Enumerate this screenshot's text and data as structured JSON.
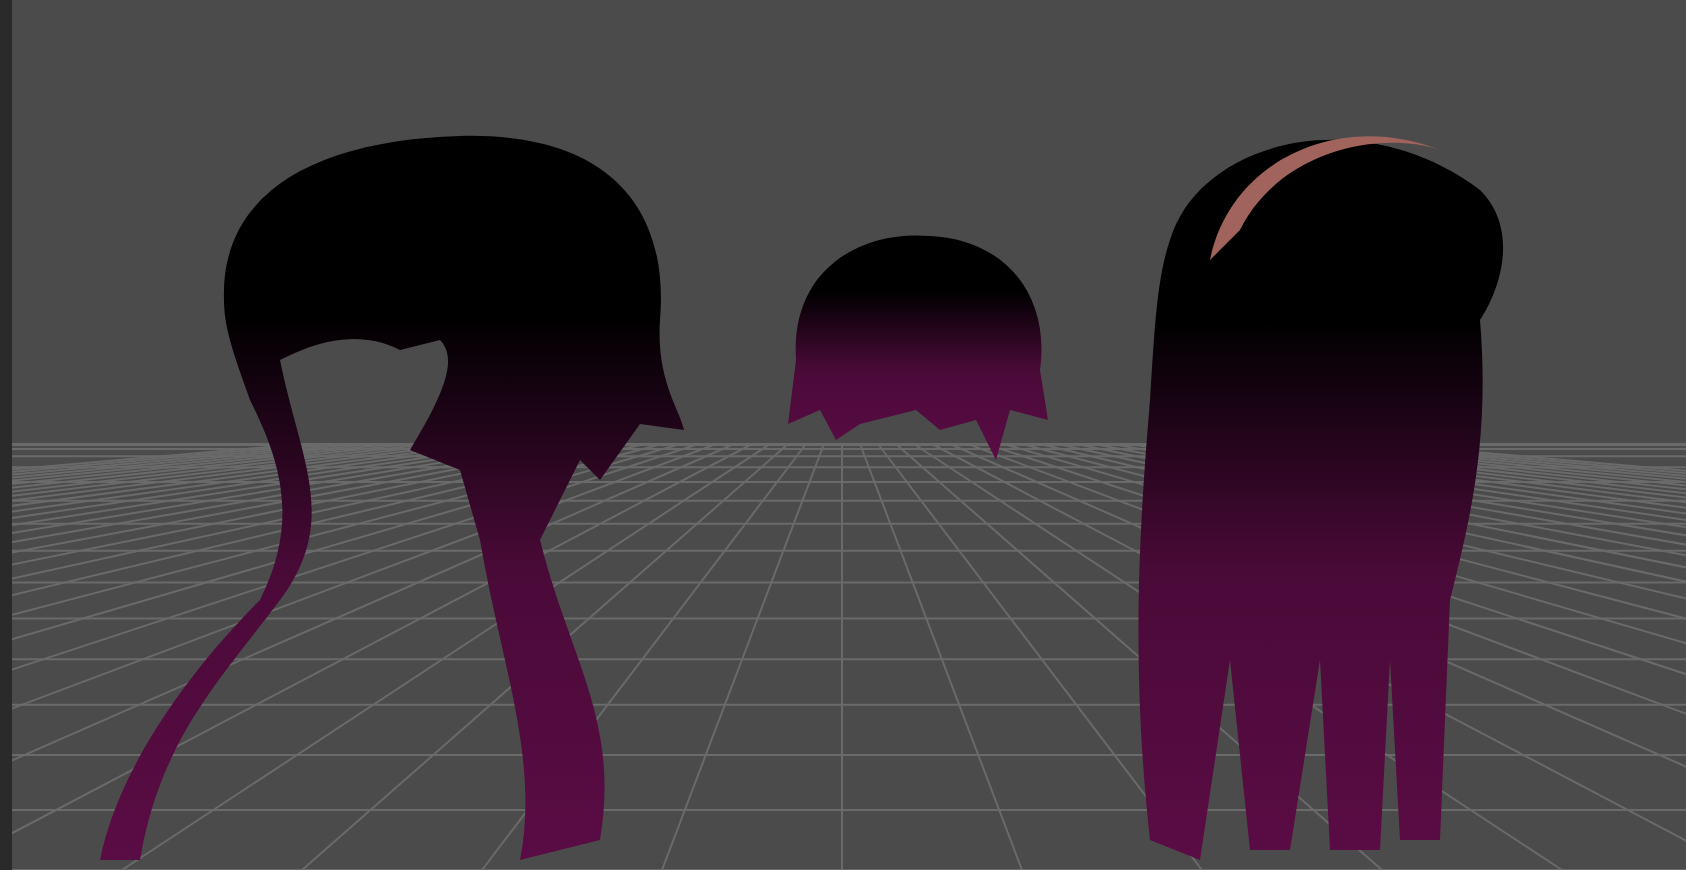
{
  "viewport": {
    "kind": "perspective-grid"
  }
}
